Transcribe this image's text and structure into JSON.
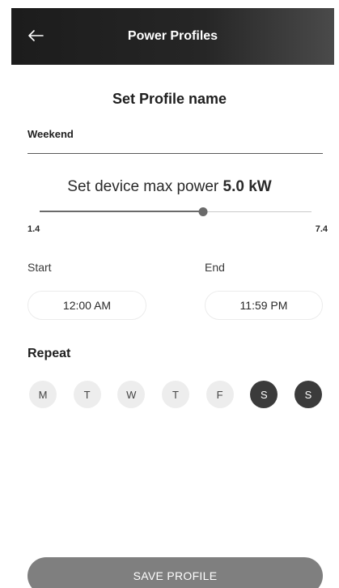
{
  "header": {
    "title": "Power Profiles",
    "back_icon": "arrow-left-icon"
  },
  "profile": {
    "section_title": "Set Profile name",
    "name_value": "Weekend"
  },
  "power": {
    "label_prefix": "Set device max power",
    "value_text": "5.0 kW",
    "value": 5.0,
    "min": 1.4,
    "max": 7.4,
    "min_label": "1.4",
    "max_label": "7.4"
  },
  "schedule": {
    "start_label": "Start",
    "start_value": "12:00 AM",
    "end_label": "End",
    "end_value": "11:59 PM"
  },
  "repeat": {
    "label": "Repeat",
    "days": [
      {
        "label": "M",
        "selected": false
      },
      {
        "label": "T",
        "selected": false
      },
      {
        "label": "W",
        "selected": false
      },
      {
        "label": "T",
        "selected": false
      },
      {
        "label": "F",
        "selected": false
      },
      {
        "label": "S",
        "selected": true
      },
      {
        "label": "S",
        "selected": true
      }
    ]
  },
  "save_button": {
    "label": "SAVE PROFILE"
  },
  "colors": {
    "header_bg": "#1c1c1c",
    "selected_day": "#3b3b3b",
    "save_button_bg": "#7f7f7f"
  }
}
